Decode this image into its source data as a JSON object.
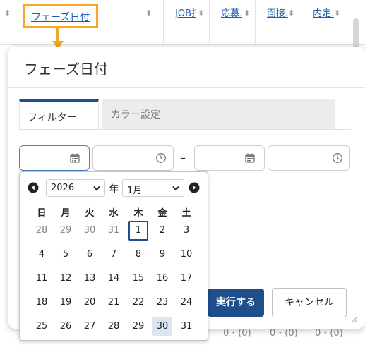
{
  "table": {
    "highlighted_header": "フェーズ日付",
    "headers": [
      "JOB打…",
      "応募…",
      "面接…",
      "内定…"
    ],
    "counts": [
      "0・(0)",
      "0・(0)",
      "0・(0)"
    ]
  },
  "modal": {
    "title": "フェーズ日付",
    "tabs": [
      "フィルター",
      "カラー設定"
    ],
    "separator": "–",
    "execute_label": "実行する",
    "cancel_label": "キャンセル"
  },
  "datepicker": {
    "year": "2026",
    "year_suffix": "年",
    "month": "1月",
    "weekdays": [
      "日",
      "月",
      "火",
      "水",
      "木",
      "金",
      "土"
    ],
    "weeks": [
      [
        "28",
        "29",
        "30",
        "31",
        "1",
        "2",
        "3"
      ],
      [
        "4",
        "5",
        "6",
        "7",
        "8",
        "9",
        "10"
      ],
      [
        "11",
        "12",
        "13",
        "14",
        "15",
        "16",
        "17"
      ],
      [
        "18",
        "19",
        "20",
        "21",
        "22",
        "23",
        "24"
      ],
      [
        "25",
        "26",
        "27",
        "28",
        "29",
        "30",
        "31"
      ]
    ],
    "today": "1",
    "selected": "30"
  },
  "colors": {
    "accent": "#1f4e8c",
    "highlight": "#f5a623",
    "link": "#1a5fb4",
    "selected_day_bg": "#dce6f2"
  },
  "icons": [
    "sort-icon",
    "calendar-icon",
    "clock-icon",
    "prev-month-icon",
    "next-month-icon",
    "chevron-down-icon",
    "resize-handle-icon"
  ]
}
